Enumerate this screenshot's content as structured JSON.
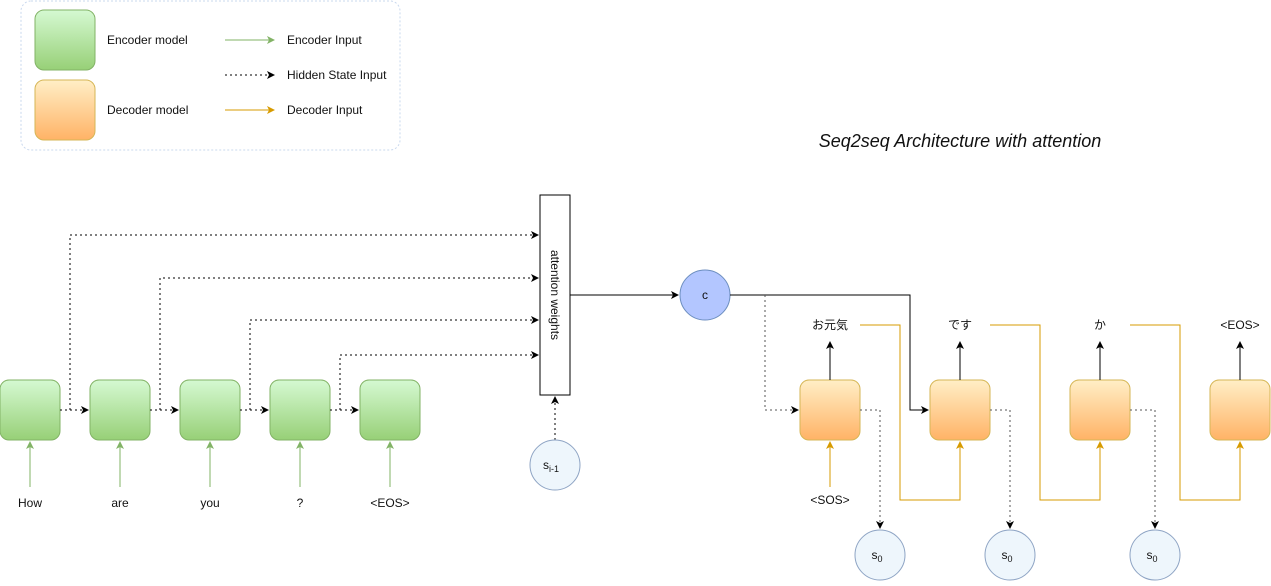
{
  "title": "Seq2seq Architecture with attention",
  "legend": {
    "encoder_model": "Encoder model",
    "decoder_model": "Decoder model",
    "encoder_input": "Encoder Input",
    "hidden_state_input": "Hidden State Input",
    "decoder_input": "Decoder Input"
  },
  "encoder_inputs": [
    "How",
    "are",
    "you",
    "?",
    "<EOS>"
  ],
  "attention_label": "attention weights",
  "context_label": "c",
  "prev_state_label": {
    "base": "s",
    "sub": "i-1"
  },
  "decoder_input_start": "<SOS>",
  "decoder_outputs": [
    "お元気",
    "です",
    "か",
    "<EOS>"
  ],
  "state_label": {
    "base": "s",
    "sub": "0"
  },
  "colors": {
    "encoder_stroke": "#82b366",
    "decoder_stroke": "#d6b656",
    "decoder_arrow": "#d79b00",
    "circle_fill": "#eef6fc",
    "circle_stroke": "#8ea4c4",
    "context_fill": "#b3c6ff"
  }
}
